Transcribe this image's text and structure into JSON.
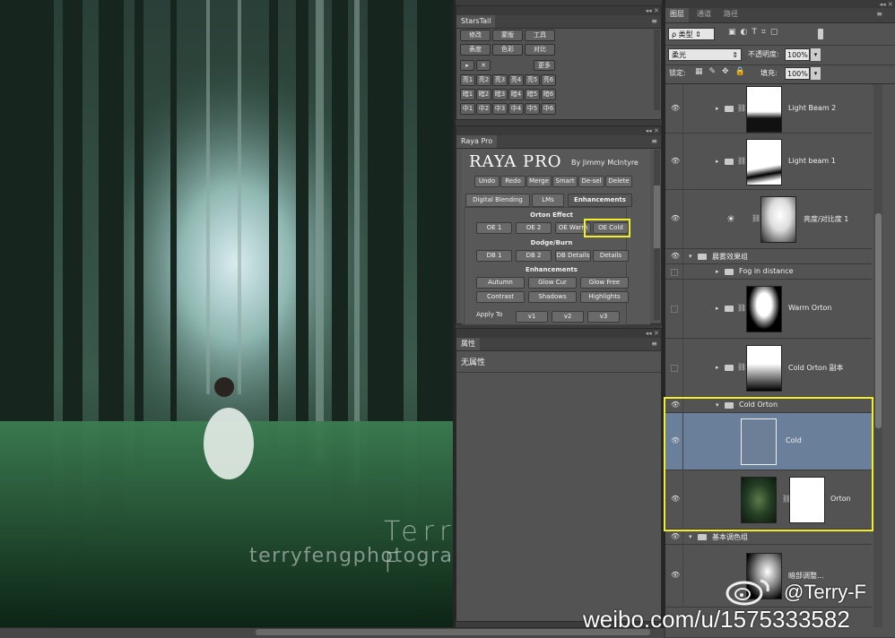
{
  "photo": {
    "watermark_name": "Terry F",
    "watermark_url": "terryfengphotography.lofter.com"
  },
  "starstail": {
    "title": "StarsTail",
    "row1": [
      "修改",
      "蒙版",
      "工具"
    ],
    "row2": [
      "表度",
      "色彩",
      "对比"
    ],
    "row3": [
      "▸",
      "✕",
      "更多"
    ],
    "grid": [
      [
        "亮1",
        "亮2",
        "亮3",
        "亮4",
        "亮5",
        "亮6"
      ],
      [
        "暗1",
        "暗2",
        "暗3",
        "暗4",
        "暗5",
        "暗6"
      ],
      [
        "中1",
        "中2",
        "中3",
        "中4",
        "中5",
        "中6"
      ]
    ]
  },
  "raya": {
    "tab": "Raya Pro",
    "logo": "RAYA PRO",
    "byline": "By Jimmy McIntyre",
    "top_buttons": [
      "Undo",
      "Redo",
      "Merge",
      "Smart",
      "De-sel",
      "Delete"
    ],
    "tabs": [
      "Digital Blending",
      "LMs",
      "Enhancements"
    ],
    "orton_heading": "Orton Effect",
    "orton_buttons": [
      "OE 1",
      "OE 2",
      "OE Warm",
      "OE Cold"
    ],
    "dodge_heading": "Dodge/Burn",
    "dodge_buttons": [
      "DB 1",
      "DB 2",
      "DB Details",
      "Details"
    ],
    "enh_heading": "Enhancements",
    "enh_row1": [
      "Autumn",
      "Glow Cur",
      "Glow Free"
    ],
    "enh_row2": [
      "Contrast",
      "Shadows",
      "Highlights"
    ],
    "apply_label": "Apply To",
    "apply_buttons": [
      "v1",
      "v2",
      "v3"
    ]
  },
  "properties": {
    "tab": "属性",
    "text": "无属性"
  },
  "layers": {
    "tabs": [
      "图层",
      "通道",
      "路径"
    ],
    "kind_filter": "ρ 类型",
    "blend_mode": "柔光",
    "opacity_label": "不透明度:",
    "opacity_value": "100%",
    "lock_label": "锁定:",
    "fill_label": "填充:",
    "fill_value": "100%",
    "rows": [
      {
        "name": "Light Beam 2",
        "visible": true
      },
      {
        "name": "Light beam 1",
        "visible": true
      },
      {
        "name": "亮度/对比度 1",
        "visible": true
      },
      {
        "name": "晨雾效果组",
        "visible": true
      },
      {
        "name": "Fog in distance",
        "visible": false
      },
      {
        "name": "Warm Orton",
        "visible": false
      },
      {
        "name": "Cold Orton 副本",
        "visible": false
      },
      {
        "name": "Cold Orton",
        "visible": true
      },
      {
        "name": "Cold",
        "visible": true
      },
      {
        "name": "Orton",
        "visible": true
      },
      {
        "name": "基本调色组",
        "visible": true
      },
      {
        "name": "暗部调整...",
        "visible": true
      }
    ]
  },
  "weibo": {
    "handle": "@Terry-F",
    "url": "weibo.com/u/1575333582"
  }
}
